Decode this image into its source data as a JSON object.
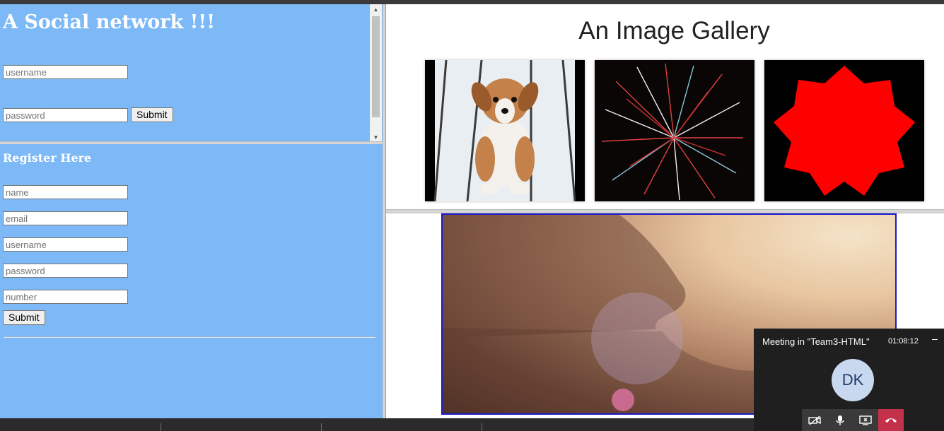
{
  "login_frame": {
    "title": "A Social network !!!",
    "username_placeholder": "username",
    "password_placeholder": "password",
    "submit_label": "Submit"
  },
  "register_frame": {
    "title": "Register Here",
    "name_placeholder": "name",
    "email_placeholder": "email",
    "username_placeholder": "username",
    "password_placeholder": "password",
    "number_placeholder": "number",
    "submit_label": "Submit"
  },
  "gallery": {
    "title": "An Image Gallery",
    "images": [
      "puppy-image",
      "fireworks-image",
      "red-star-image"
    ]
  },
  "video": {
    "description_icon": "video-frame"
  },
  "meeting": {
    "title": "Meeting in \"Team3-HTML\"",
    "time": "01:08:12",
    "minimize_label": "–",
    "avatar_initials": "DK",
    "controls": [
      "camera-off-icon",
      "microphone-icon",
      "share-screen-icon",
      "hang-up-icon"
    ]
  },
  "colors": {
    "frame_blue": "#7db9f7",
    "hangup_red": "#c4314b",
    "video_border": "#1a1acc"
  }
}
